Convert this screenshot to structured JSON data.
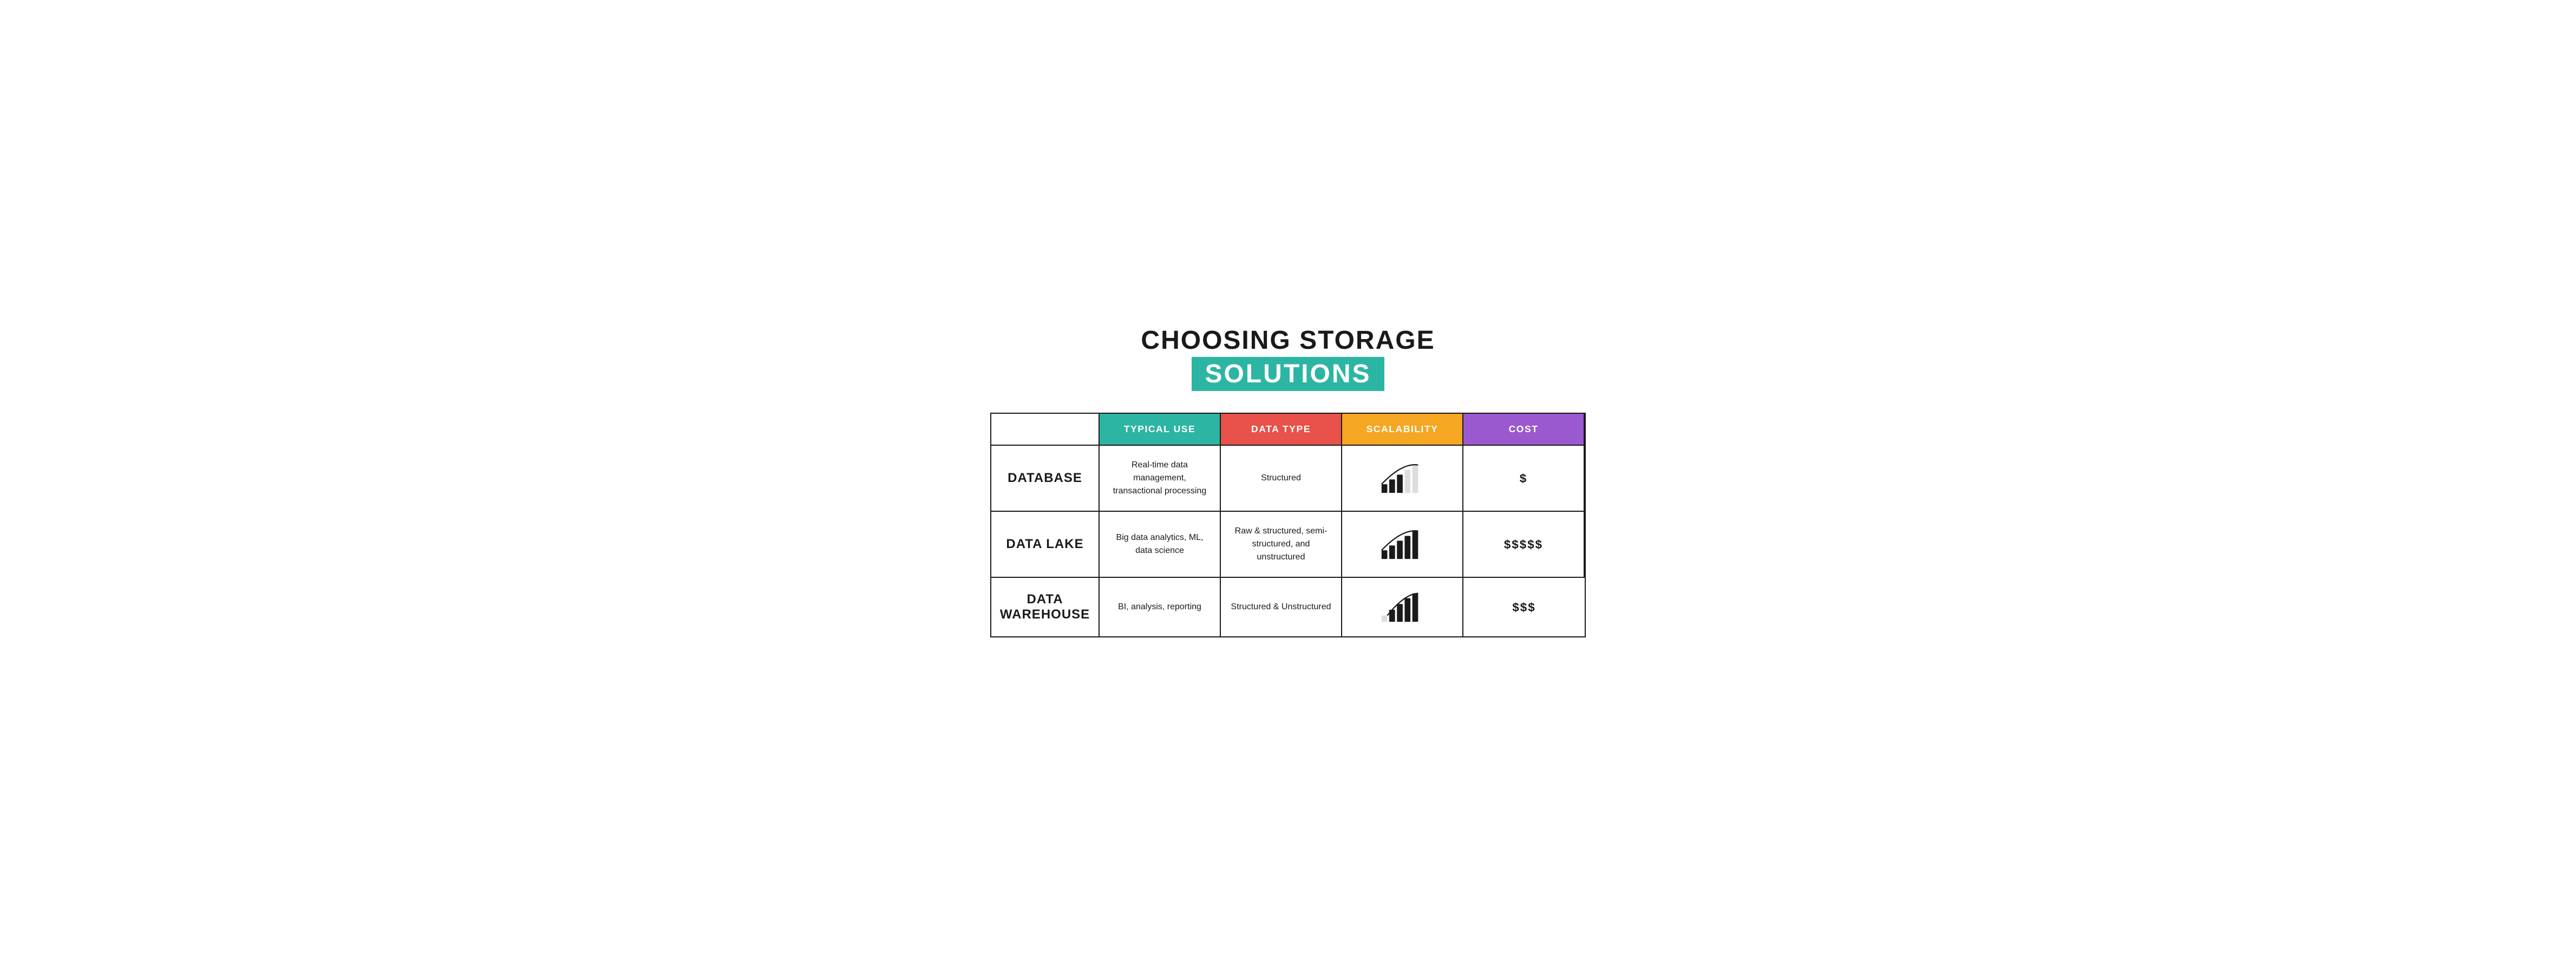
{
  "title": {
    "line1": "CHOOSING STORAGE",
    "line2": "SOLUTIONS"
  },
  "headers": {
    "empty": "",
    "typical_use": "TYPICAL USE",
    "data_type": "DATA TYPE",
    "scalability": "SCALABILITY",
    "cost": "COST"
  },
  "rows": [
    {
      "label": "DATABASE",
      "typical_use": "Real-time data management, transactional processing",
      "data_type": "Structured",
      "scalability_bars": [
        1,
        2,
        3,
        4,
        5
      ],
      "scalability_filled": 3,
      "cost": "$"
    },
    {
      "label": "DATA LAKE",
      "typical_use": "Big data analytics, ML, data science",
      "data_type": "Raw & structured, semi-structured, and unstructured",
      "scalability_bars": [
        1,
        2,
        3,
        4,
        5
      ],
      "scalability_filled": 5,
      "cost": "$$$$$"
    },
    {
      "label": "DATA\nWAREHOUSE",
      "typical_use": "BI, analysis, reporting",
      "data_type": "Structured & Unstructured",
      "scalability_bars": [
        1,
        2,
        3,
        4,
        5
      ],
      "scalability_filled": 4,
      "cost": "$$$"
    }
  ]
}
